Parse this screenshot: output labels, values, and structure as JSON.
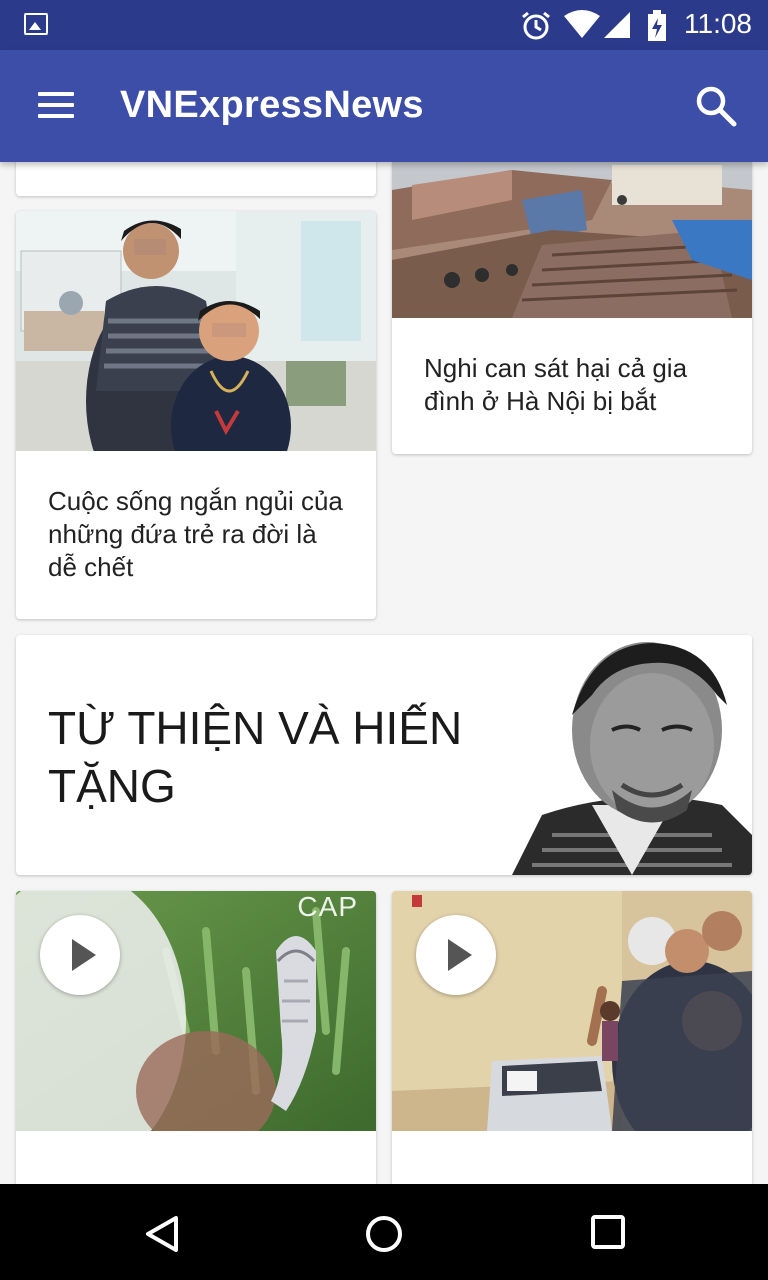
{
  "status_bar": {
    "time": "11:08",
    "icons": [
      "gallery-icon",
      "alarm-icon",
      "wifi-icon",
      "signal-icon",
      "battery-icon"
    ]
  },
  "app_bar": {
    "title": "VNExpressNews",
    "icons": [
      "menu-icon",
      "search-icon"
    ]
  },
  "feed": {
    "cards": [
      {
        "id": "partial-top",
        "headline": ""
      },
      {
        "id": "children-hospital",
        "headline": "Cuộc sống ngắn ngủi của những đứa trẻ ra đời là dễ chết"
      },
      {
        "id": "rooftops",
        "headline": "Nghi can sát hại cả gia đình ở Hà Nội bị bắt"
      }
    ],
    "banner": {
      "title": "TỪ THIỆN VÀ HIẾN TẶNG"
    },
    "videos": [
      {
        "id": "cobra",
        "watermark": "CAP",
        "headline": ""
      },
      {
        "id": "crowd-washer",
        "headline": ""
      }
    ]
  },
  "colors": {
    "status_bar": "#2c3a8c",
    "app_bar": "#3d4ea8",
    "background": "#f5f5f5",
    "nav_bar": "#000000"
  }
}
